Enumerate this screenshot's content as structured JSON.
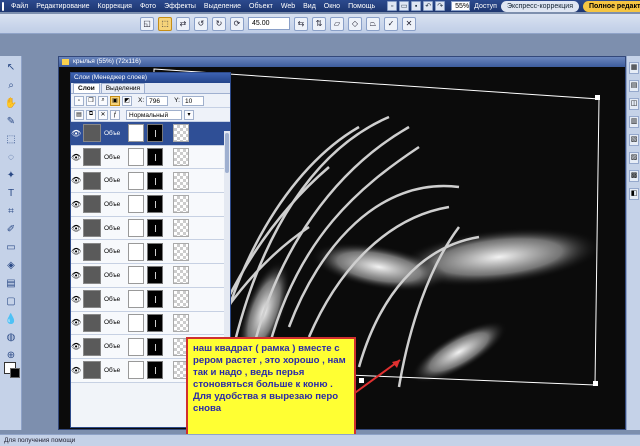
{
  "menu": {
    "items": [
      "Файл",
      "Редактирование",
      "Коррекция",
      "Фото",
      "Эффекты",
      "Выделение",
      "Объект",
      "Web",
      "Вид",
      "Окно",
      "Помощь"
    ],
    "zoom": "55%",
    "access_label": "Доступ",
    "mode_quick": "Экспресс-коррекция",
    "mode_full": "Полное редактиров..."
  },
  "options": {
    "angle": "45.00"
  },
  "document": {
    "title": "крылья (55%) (72x116)"
  },
  "layers_panel": {
    "title": "Слои (Менеджер слоев)",
    "tabs": [
      "Слои",
      "Выделения"
    ],
    "x_label": "X:",
    "x_value": "796",
    "y_label": "Y:",
    "y_value": "10",
    "blend_mode": "Нормальный",
    "layer_name": "Объе",
    "layer_count": 11
  },
  "annotation": {
    "text": "наш квадрат ( рамка ) вместе с рером растет , это хорошо , нам так и надо , ведь перья стоновяться больше к коню . Для удобства я вырезаю перо снова",
    "color": "#2a2aa8",
    "background": "#ffff33",
    "border": "#d0302e"
  },
  "status": {
    "text": "Для получения помощи"
  },
  "colors": {
    "accent": "#2f4f96",
    "canvas": "#0b0b0b"
  }
}
